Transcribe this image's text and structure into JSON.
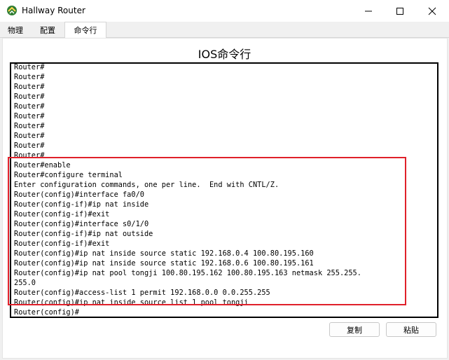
{
  "window": {
    "title": "Hallway Router",
    "minimize_icon": "minimize-icon",
    "maximize_icon": "maximize-icon",
    "close_icon": "close-icon"
  },
  "tabs": [
    {
      "label": "物理"
    },
    {
      "label": "配置"
    },
    {
      "label": "命令行"
    }
  ],
  "main": {
    "title": "IOS命令行"
  },
  "console": {
    "lines": [
      "Router#",
      "Router#",
      "Router#",
      "Router#",
      "Router#",
      "Router#",
      "Router#",
      "Router#",
      "Router#",
      "Router#",
      "Router#enable",
      "Router#configure terminal",
      "Enter configuration commands, one per line.  End with CNTL/Z.",
      "Router(config)#interface fa0/0",
      "Router(config-if)#ip nat inside",
      "Router(config-if)#exit",
      "Router(config)#interface s0/1/0",
      "Router(config-if)#ip nat outside",
      "Router(config-if)#exit",
      "Router(config)#ip nat inside source static 192.168.0.4 100.80.195.160",
      "Router(config)#ip nat inside source static 192.168.0.6 100.80.195.161",
      "Router(config)#ip nat pool tongji 100.80.195.162 100.80.195.163 netmask 255.255.",
      "255.0",
      "Router(config)#access-list 1 permit 192.168.0.0 0.0.255.255",
      "Router(config)#ip nat inside source list 1 pool tongji",
      "Router(config)#"
    ]
  },
  "buttons": {
    "copy": "复制",
    "paste": "粘贴"
  },
  "colors": {
    "highlight_border": "#e0202a",
    "console_border": "#000000"
  }
}
